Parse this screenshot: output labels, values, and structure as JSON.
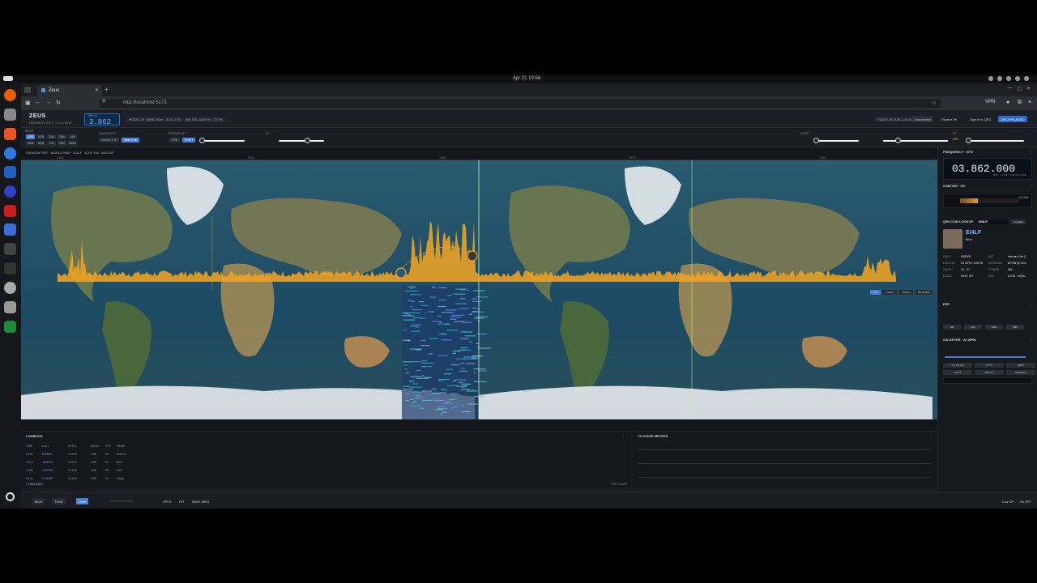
{
  "os": {
    "clock": "Apr 21  19:56"
  },
  "browser": {
    "tab_title": "Zeus",
    "url": "http://localhost:5173",
    "vpn_label": "VPN"
  },
  "header": {
    "app_name": "ZEUS",
    "app_sub": "HERMES LITE 2 · 3.1.0 MHZ",
    "vfo_label": "VFO A",
    "vfo_value": "3.862",
    "chips": [
      "MODE  LSB",
      "BAND  80m",
      "AGC-T  80",
      "BW  300–3300 Hz",
      "TX  RX"
    ],
    "radio_label": "RADIO  192.168.1.40:1024",
    "disconnect": "Disconnect",
    "rotator": "Rotator  off",
    "signin": "Sign in to QRZ",
    "qrz_status": "QRZ ENGAGED"
  },
  "controls": {
    "modes_row1": [
      "LSB",
      "USB",
      "CWL",
      "CWU",
      "AM"
    ],
    "modes_row2": [
      "SAM",
      "DSB",
      "FM",
      "DIGL",
      "DIGU"
    ],
    "active_mode": "LSB",
    "bw_label": "BANDWIDTH",
    "bw_buttons": [
      "Narrow 2.7k",
      "Wide 2.9k"
    ],
    "active_bw": "Wide 2.9k",
    "preamp_label": "PREAMP/ATT",
    "preamp_buttons": [
      "PRE",
      "-6 ATT"
    ],
    "zoom_label": "ZOOM",
    "af_label": "AF",
    "rf_label": "RF",
    "rf_value": "50%"
  },
  "panadapter": {
    "title": "PANADAPTER · WORLD MAP · EI4LF · 6,297 KM · BRG 65°",
    "ruler_ticks": [
      "3.842",
      "3.852",
      "3.862",
      "3.872",
      "3.882"
    ],
    "overlay_buttons": [
      "Grid",
      "Labels",
      "Terrain",
      "DE FIXED"
    ]
  },
  "sidebar": {
    "freq_title": "FREQUENCY · VFO",
    "freq_value": "03.862.000",
    "freq_hint": "MHZ · CLICK TO ENTER MHZ",
    "smeter_title": "S-METER · RX",
    "smeter_value": "-93 dBm",
    "qrz_title": "QRZ.COM LOOKUP",
    "qrz_input": "EI4LF",
    "qrz_lookup": "Lookup",
    "callsign": "EI4LF",
    "name": "Brian",
    "fields": [
      [
        "GRID",
        "IO63VD",
        "RIG",
        "Hermes Lite 2"
      ],
      [
        "LAT/LON",
        "53.20°N / 8.00°W",
        "ANTENNA",
        "EFHW @ 10m"
      ],
      [
        "CQ/ITU",
        "14 · 27",
        "POWER",
        "5W"
      ],
      [
        "LOCAL",
        "18:57 IST",
        "QSL",
        "LoTW · eQSL"
      ]
    ],
    "dsp_title": "DSP",
    "dsp_buttons": [
      "NR",
      "ANF",
      "SNB",
      "NBP"
    ],
    "cw_title": "CW KEYER · 22 WPM",
    "cw_buttons": [
      "CQ CQ CQ",
      "TU 73",
      "QRZ?",
      "AGN?",
      "5NN TU",
      "DE EI4LF"
    ]
  },
  "logbook": {
    "title": "LOGBOOK",
    "headers": [
      "TIME",
      "CALL",
      "FREQ",
      "MODE",
      "RST",
      "NAME"
    ],
    "rows": [
      [
        "18:57",
        "W1ABC",
        "14.210",
        "USB",
        "59",
        "Warren"
      ],
      [
        "18:14",
        "JA1XYZ",
        "14.213",
        "USB",
        "57",
        "Akio"
      ],
      [
        "18:08",
        "VK4FDR",
        "21.295",
        "USB",
        "58",
        "Dale"
      ],
      [
        "18:41",
        "LU1DEF",
        "14.205",
        "USB",
        "59",
        "Diego"
      ]
    ],
    "add_label": "+ Add QSO",
    "count": "7 OF 7 LAST"
  },
  "tx_meters": {
    "title": "TX STAGE METERS"
  },
  "footer": {
    "buttons": [
      "MOX",
      "TUNE",
      "SPLIT",
      "RIT",
      "SAVE MEM"
    ],
    "drive_label": "Drive",
    "right_chips": [
      "Low  GP",
      "PA  OFF"
    ]
  },
  "colors": {
    "accent": "#4a90e2",
    "spectrum": "#f5a623",
    "bg": "#181b20"
  }
}
